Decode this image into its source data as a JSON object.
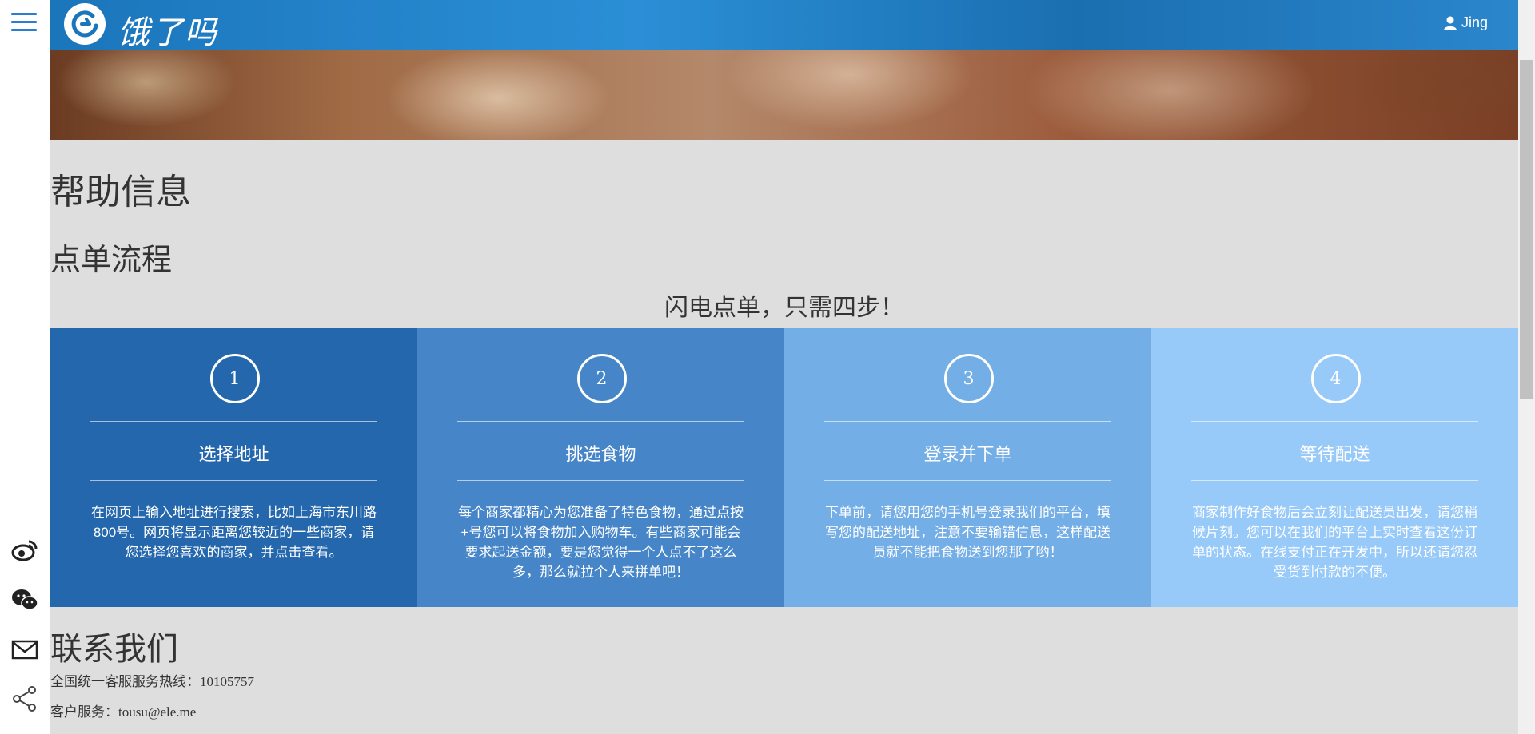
{
  "header": {
    "logo_text": "饿了吗",
    "user_name": "Jing"
  },
  "page": {
    "title": "帮助信息",
    "section_title": "点单流程",
    "slogan": "闪电点单，只需四步！"
  },
  "steps": [
    {
      "number": "1",
      "title": "选择地址",
      "desc": "在网页上输入地址进行搜索，比如上海市东川路800号。网页将显示距离您较近的一些商家，请您选择您喜欢的商家，并点击查看。",
      "color": "#2467ad"
    },
    {
      "number": "2",
      "title": "挑选食物",
      "desc": "每个商家都精心为您准备了特色食物，通过点按+号您可以将食物加入购物车。有些商家可能会要求起送金额，要是您觉得一个人点不了这么多，那么就拉个人来拼单吧！",
      "color": "#4686c8"
    },
    {
      "number": "3",
      "title": "登录并下单",
      "desc": "下单前，请您用您的手机号登录我们的平台，填写您的配送地址，注意不要输错信息，这样配送员就不能把食物送到您那了哟！",
      "color": "#74aee6"
    },
    {
      "number": "4",
      "title": "等待配送",
      "desc": "商家制作好食物后会立刻让配送员出发，请您稍候片刻。您可以在我们的平台上实时查看这份订单的状态。在线支付正在开发中，所以还请您忍受货到付款的不便。",
      "color": "#97c9f9"
    }
  ],
  "contact": {
    "title": "联系我们",
    "hotline": "全国统一客服服务热线：10105757",
    "email": "客户服务：tousu@ele.me"
  },
  "icons": {
    "menu": "menu-icon",
    "weibo": "weibo-icon",
    "wechat": "wechat-icon",
    "mail": "mail-icon",
    "share": "share-icon",
    "user": "user-icon"
  }
}
